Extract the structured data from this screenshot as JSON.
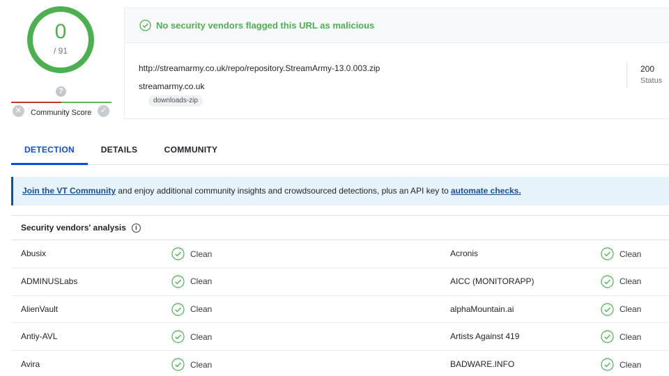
{
  "score": {
    "detections": "0",
    "total": "/ 91",
    "community_label": "Community Score",
    "ring_color": "#4caf50"
  },
  "summary": {
    "message": "No security vendors flagged this URL as malicious",
    "url": "http://streamarmy.co.uk/repo/repository.StreamArmy-13.0.003.zip",
    "domain": "streamarmy.co.uk",
    "tag": "downloads-zip",
    "status_code": "200",
    "status_label": "Status"
  },
  "tabs": [
    {
      "label": "DETECTION",
      "active": true
    },
    {
      "label": "DETAILS",
      "active": false
    },
    {
      "label": "COMMUNITY",
      "active": false
    }
  ],
  "banner": {
    "link1": "Join the VT Community",
    "middle": " and enjoy additional community insights and crowdsourced detections, plus an API key to ",
    "link2": "automate checks."
  },
  "vendors": {
    "title": "Security vendors' analysis",
    "rows": [
      {
        "left_name": "Abusix",
        "left_result": "Clean",
        "right_name": "Acronis",
        "right_result": "Clean"
      },
      {
        "left_name": "ADMINUSLabs",
        "left_result": "Clean",
        "right_name": "AICC (MONITORAPP)",
        "right_result": "Clean"
      },
      {
        "left_name": "AlienVault",
        "left_result": "Clean",
        "right_name": "alphaMountain.ai",
        "right_result": "Clean"
      },
      {
        "left_name": "Antiy-AVL",
        "left_result": "Clean",
        "right_name": "Artists Against 419",
        "right_result": "Clean"
      },
      {
        "left_name": "Avira",
        "left_result": "Clean",
        "right_name": "BADWARE.INFO",
        "right_result": "Clean"
      }
    ]
  },
  "colors": {
    "clean_green": "#4caf50",
    "active_tab": "#0b4dda",
    "link_blue": "#1b4f8a"
  }
}
